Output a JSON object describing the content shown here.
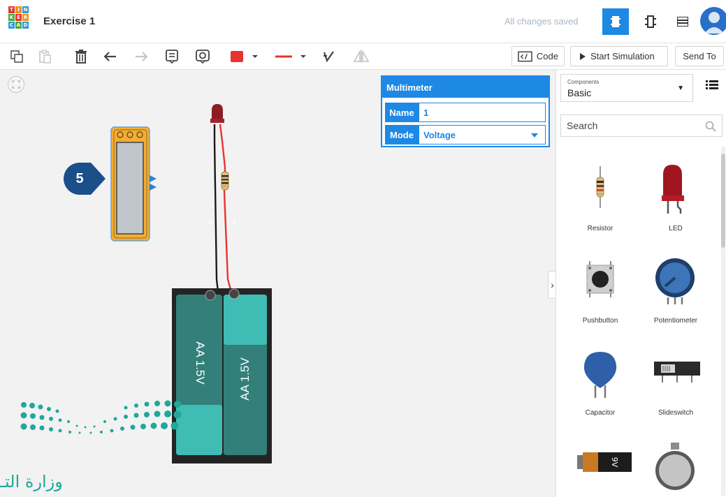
{
  "app": {
    "logo_letters": [
      "T",
      "I",
      "N",
      "K",
      "E",
      "R",
      "C",
      "A",
      "D"
    ],
    "logo_colors": [
      "#e8332f",
      "#f58f1e",
      "#2c9ad6",
      "#4aa83b",
      "#e8332f",
      "#f58f1e",
      "#2c9ad6",
      "#4aa83b",
      "#2c9ad6"
    ],
    "project_title": "Exercise 1",
    "save_status": "All changes saved",
    "accent_color": "#1e88e5"
  },
  "toolbar": {
    "code_label": "Code",
    "start_sim_label": "Start Simulation",
    "send_to_label": "Send To",
    "fill_color": "#e8332f",
    "wire_color": "#e8332f",
    "icons": [
      "copy-icon",
      "paste-icon",
      "delete-icon",
      "undo-icon",
      "redo-icon",
      "notes-icon",
      "note-toggle-icon",
      "color-swatch-icon",
      "wire-style-icon",
      "align-icon",
      "flip-icon"
    ]
  },
  "multimeter": {
    "title": "Multimeter",
    "name_label": "Name",
    "name_value": "1",
    "mode_label": "Mode",
    "mode_value": "Voltage"
  },
  "battery": {
    "cell_1_label": "AA 1.5V",
    "cell_2_label": "AA 1.5V",
    "negative": "−",
    "positive": "+"
  },
  "callout": {
    "number": "5"
  },
  "sidebar": {
    "components_small_label": "Components",
    "components_value": "Basic",
    "search_placeholder": "Search",
    "items": [
      {
        "label": "Resistor",
        "icon": "resistor-icon"
      },
      {
        "label": "LED",
        "icon": "led-icon"
      },
      {
        "label": "Pushbutton",
        "icon": "pushbutton-icon"
      },
      {
        "label": "Potentiometer",
        "icon": "potentiometer-icon"
      },
      {
        "label": "Capacitor",
        "icon": "capacitor-icon"
      },
      {
        "label": "Slideswitch",
        "icon": "slideswitch-icon"
      },
      {
        "label": "9V",
        "icon": "battery-9v-icon"
      },
      {
        "label": "",
        "icon": "coin-battery-icon"
      }
    ]
  },
  "watermark": {
    "text": "وزارة التـ"
  }
}
